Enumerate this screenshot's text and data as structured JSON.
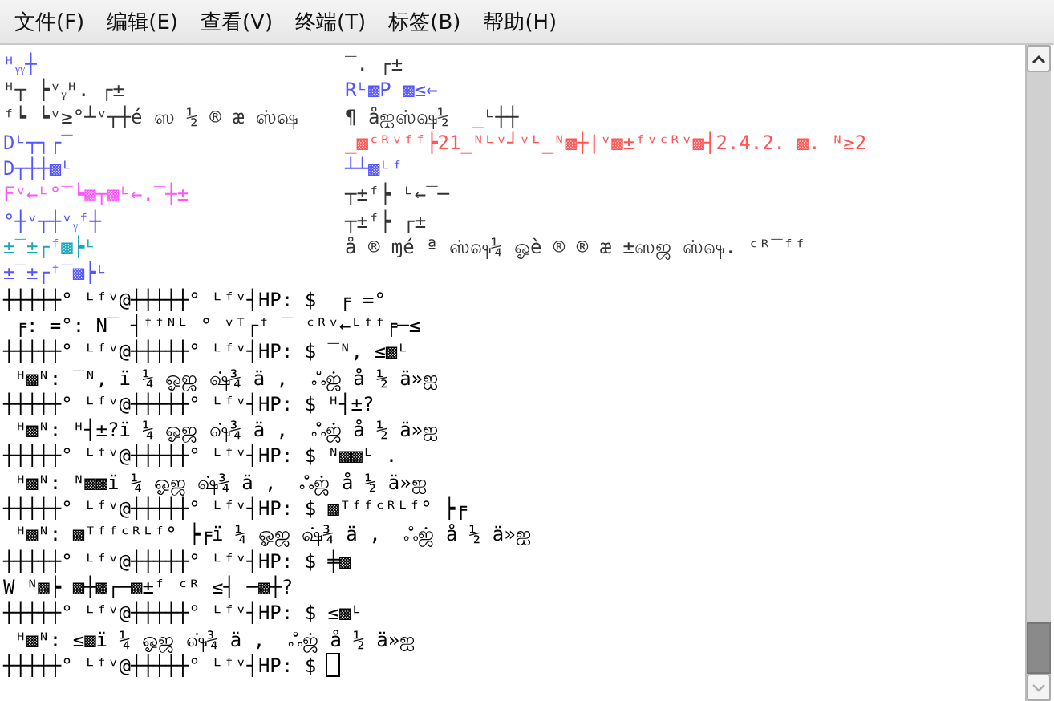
{
  "menu": [
    {
      "label": "文件(F)"
    },
    {
      "label": "编辑(E)"
    },
    {
      "label": "查看(V)"
    },
    {
      "label": "终端(T)"
    },
    {
      "label": "标签(B)"
    },
    {
      "label": "帮助(H)"
    }
  ],
  "terminal": {
    "left_lines": [
      {
        "text": "ᴴᵧᵧ┼",
        "color": "#5555ff"
      },
      {
        "text": "ᴴ┬ ┝ᵛᵧᴴ. ┌±",
        "color": "#333333"
      },
      {
        "text": "ᶠ┕ ┕ᵛ≥°┴ᵛ┬┼é ஸ ½ ® æ ஸ்ஷ",
        "color": "#333333"
      },
      {
        "text": "Dᴸ┬┐┌‾",
        "color": "#5555ff"
      },
      {
        "text": "D┬┼┼▩ᴸ",
        "color": "#5555ff"
      },
      {
        "text": "Fᵛ←ᴸ°‾┕▩┬▩ᴸ←.‾┼±",
        "color": "#ff55ff"
      },
      {
        "text": "°┼ᵛ┬┼ᵛᵧᶠ┼",
        "color": "#5555ff"
      },
      {
        "text": "±‾±┌ᶠ▩┝ᴸ",
        "color": "#1aa8b8"
      },
      {
        "text": "±‾±┌ᶠ‾▩┝ᴸ",
        "color": "#5555ff"
      }
    ],
    "right_lines": [
      {
        "text": "‾. ┌±",
        "color": "#333333"
      },
      {
        "text": "Rᴸ▩P ▩≤←",
        "color": "#5555ff"
      },
      {
        "text": "¶ åஐஸ்ஷ½  _ᴸ┼┼",
        "color": "#333333"
      },
      {
        "text": "_▩ᶜᴿᵛᶠᶠ┝21_ᴺᴸᵛ┘ᵛᴸ_ᴺ▩┼|ᵛ▩±ᶠᵛᶜᴿᵛ▩┤2.4.2. ▩. ᴺ≥2",
        "color": "#ff5555"
      },
      {
        "text": "┴┴▩ᴸᶠ",
        "color": "#5555ff"
      },
      {
        "text": "┬±ᶠ┝ ᴸ←‾─",
        "color": "#333333"
      },
      {
        "text": "┬±ᶠ┝ ┌±",
        "color": "#333333"
      },
      {
        "text": "å ® ɱé ª ஸ்ஷ¼ ஓè ® ® æ ±ஸஜ ஸ்ஷ. ᶜᴿ‾ᶠᶠ",
        "color": "#333333"
      }
    ],
    "lines": [
      {
        "text": "┼┼┼┼┼° ᴸᶠᵛ@┼┼┼┼┼° ᴸᶠᵛ┤HP: $  ╒ =°",
        "color": "#000000"
      },
      {
        "text": " ╒: =°: N‾ ┤ᶠᶠᴺᴸ ° ᵛᵀ┌ᶠ ‾ ᶜᴿᵛ←ᴸᶠᶠ╒─≤",
        "color": "#000000"
      },
      {
        "text": "┼┼┼┼┼° ᴸᶠᵛ@┼┼┼┼┼° ᴸᶠᵛ┤HP: $ ‾ᴺ, ≤▩ᴸ",
        "color": "#000000"
      },
      {
        "text": " ᴴ▩ᴺ: ‾ᴺ, ï ¼ ஓஜ ஷ்¾ ä ,  ஃஜ் å ½ ä»ஐ",
        "color": "#000000"
      },
      {
        "text": "┼┼┼┼┼° ᴸᶠᵛ@┼┼┼┼┼° ᴸᶠᵛ┤HP: $ ᴴ┤±?",
        "color": "#000000"
      },
      {
        "text": " ᴴ▩ᴺ: ᴴ┤±?ï ¼ ஓஜ ஷ்¾ ä ,  ஃஜ் å ½ ä»ஐ",
        "color": "#000000"
      },
      {
        "text": "┼┼┼┼┼° ᴸᶠᵛ@┼┼┼┼┼° ᴸᶠᵛ┤HP: $ ᴺ▩▩ᴸ .",
        "color": "#000000"
      },
      {
        "text": " ᴴ▩ᴺ: ᴺ▩▩ï ¼ ஓஜ ஷ்¾ ä ,  ஃஜ் å ½ ä»ஐ",
        "color": "#000000"
      },
      {
        "text": "┼┼┼┼┼° ᴸᶠᵛ@┼┼┼┼┼° ᴸᶠᵛ┤HP: $ ▩ᵀᶠᶠᶜᴿᴸᶠ° ┝╒",
        "color": "#000000"
      },
      {
        "text": " ᴴ▩ᴺ: ▩ᵀᶠᶠᶜᴿᴸᶠ° ┝╒ï ¼ ஓஜ ஷ்¾ ä ,  ஃஜ் å ½ ä»ஐ",
        "color": "#000000"
      },
      {
        "text": "┼┼┼┼┼° ᴸᶠᵛ@┼┼┼┼┼° ᴸᶠᵛ┤HP: $ ╪▩",
        "color": "#000000"
      },
      {
        "text": "W ᴺ▩┝ ▩┼▩┌─▩±ᶠ ᶜᴿ ≤┤ ─▩┼?",
        "color": "#000000"
      },
      {
        "text": "┼┼┼┼┼° ᴸᶠᵛ@┼┼┼┼┼° ᴸᶠᵛ┤HP: $ ≤▩ᴸ",
        "color": "#000000"
      },
      {
        "text": " ᴴ▩ᴺ: ≤▩ï ¼ ஓஜ ஷ்¾ ä ,  ஃஜ் å ½ ä»ஐ",
        "color": "#000000"
      },
      {
        "text": "┼┼┼┼┼° ᴸᶠᵛ@┼┼┼┼┼° ᴸᶠᵛ┤HP: $",
        "color": "#000000"
      }
    ]
  }
}
